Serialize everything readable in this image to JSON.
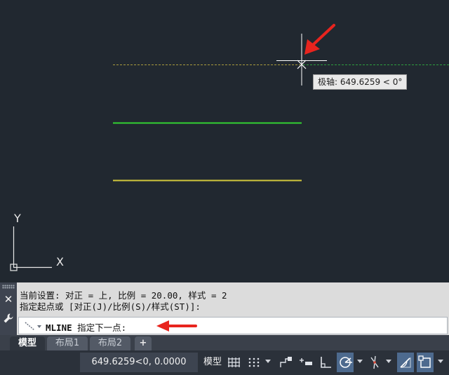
{
  "tooltip": {
    "label": "极轴: 649.6259 < 0°"
  },
  "ucs": {
    "x_label": "X",
    "y_label": "Y"
  },
  "colors": {
    "canvas_bg": "#212830",
    "line_green": "#32d232",
    "line_yellow": "#d2c83c",
    "tracking_yellow": "#a89a3c",
    "tracking_green": "#2e9e3e",
    "arrow_red": "#e8241e",
    "active_toggle": "#4d6a8e"
  },
  "command": {
    "history": [
      "当前设置: 对正 = 上, 比例 = 20.00, 样式 = 2",
      "指定起点或 [对正(J)/比例(S)/样式(ST)]:"
    ],
    "prompt_cmd": "MLINE",
    "prompt_text": " 指定下一点:",
    "close_icon": "close-icon",
    "customize_icon": "wrench-icon"
  },
  "tabs": [
    {
      "label": "模型",
      "active": true
    },
    {
      "label": "布局1",
      "active": false
    },
    {
      "label": "布局2",
      "active": false
    },
    {
      "label": "+",
      "active": false
    }
  ],
  "status": {
    "coordinates": "649.6259<0, 0.0000",
    "model_label": "模型",
    "icons": [
      "grid-icon",
      "snap-dots-icon",
      "infer-constraints-icon",
      "dynamic-input-icon",
      "ortho-icon",
      "polar-tracking-icon",
      "isodraft-icon",
      "object-snap-tracking-icon",
      "object-snap-icon"
    ]
  }
}
